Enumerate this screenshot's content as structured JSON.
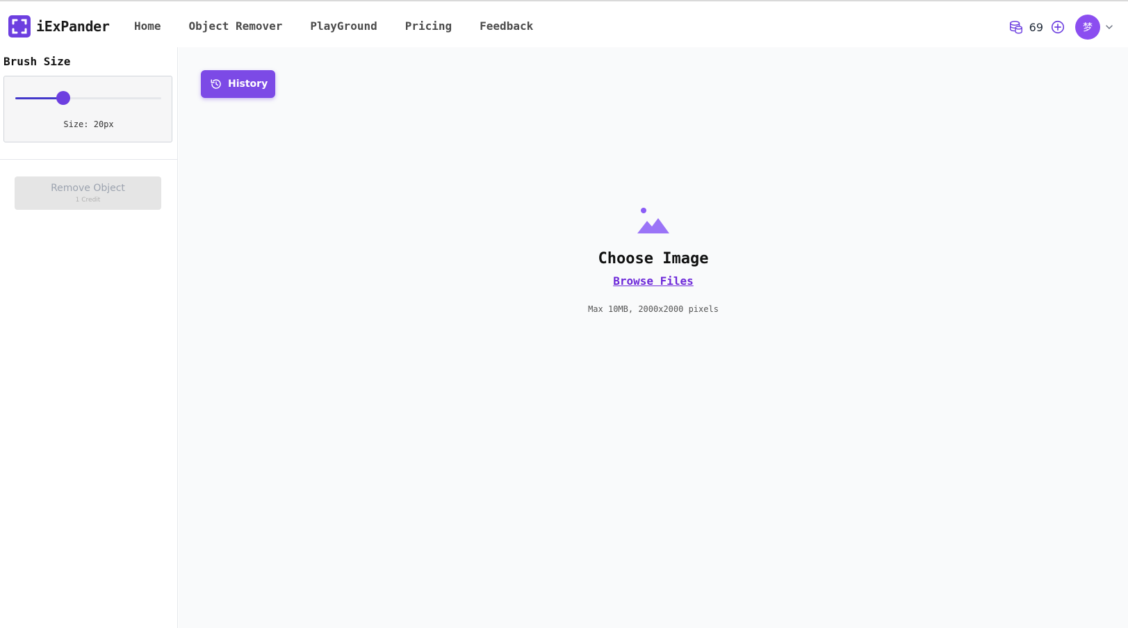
{
  "app": {
    "name": "iExPander"
  },
  "nav": {
    "items": [
      "Home",
      "Object Remover",
      "PlayGround",
      "Pricing",
      "Feedback"
    ]
  },
  "user": {
    "credits": "69",
    "avatar_initial": "梦"
  },
  "sidebar": {
    "title": "Brush Size",
    "brush": {
      "size_label": "Size: 20px",
      "value_fraction": 0.33
    },
    "remove_button": {
      "label": "Remove Object",
      "sub": "1 Credit"
    }
  },
  "main": {
    "history_label": "History",
    "upload": {
      "title": "Choose Image",
      "browse_label": "Browse Files",
      "limits": "Max 10MB, 2000x2000 pixels"
    }
  },
  "colors": {
    "accent": "#6d3fe0",
    "link": "#6d28d9",
    "history_bg": "#7c4ae6"
  }
}
